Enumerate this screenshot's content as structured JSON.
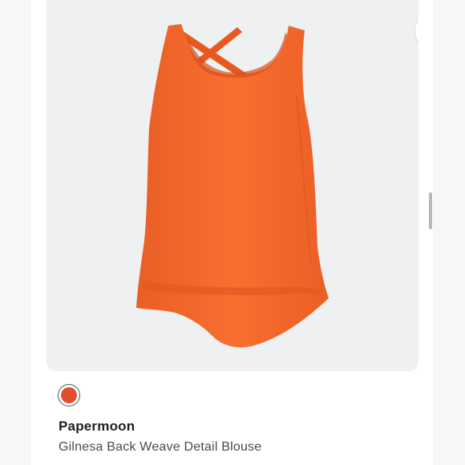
{
  "product": {
    "brand": "Papermoon",
    "title": "Gilnesa Back Weave Detail Blouse",
    "color_swatch": "#e0502f",
    "garment_color": "#f56a2e"
  },
  "actions": {
    "more_icon": "more-horizontal-icon",
    "more_glyph": "•••"
  }
}
